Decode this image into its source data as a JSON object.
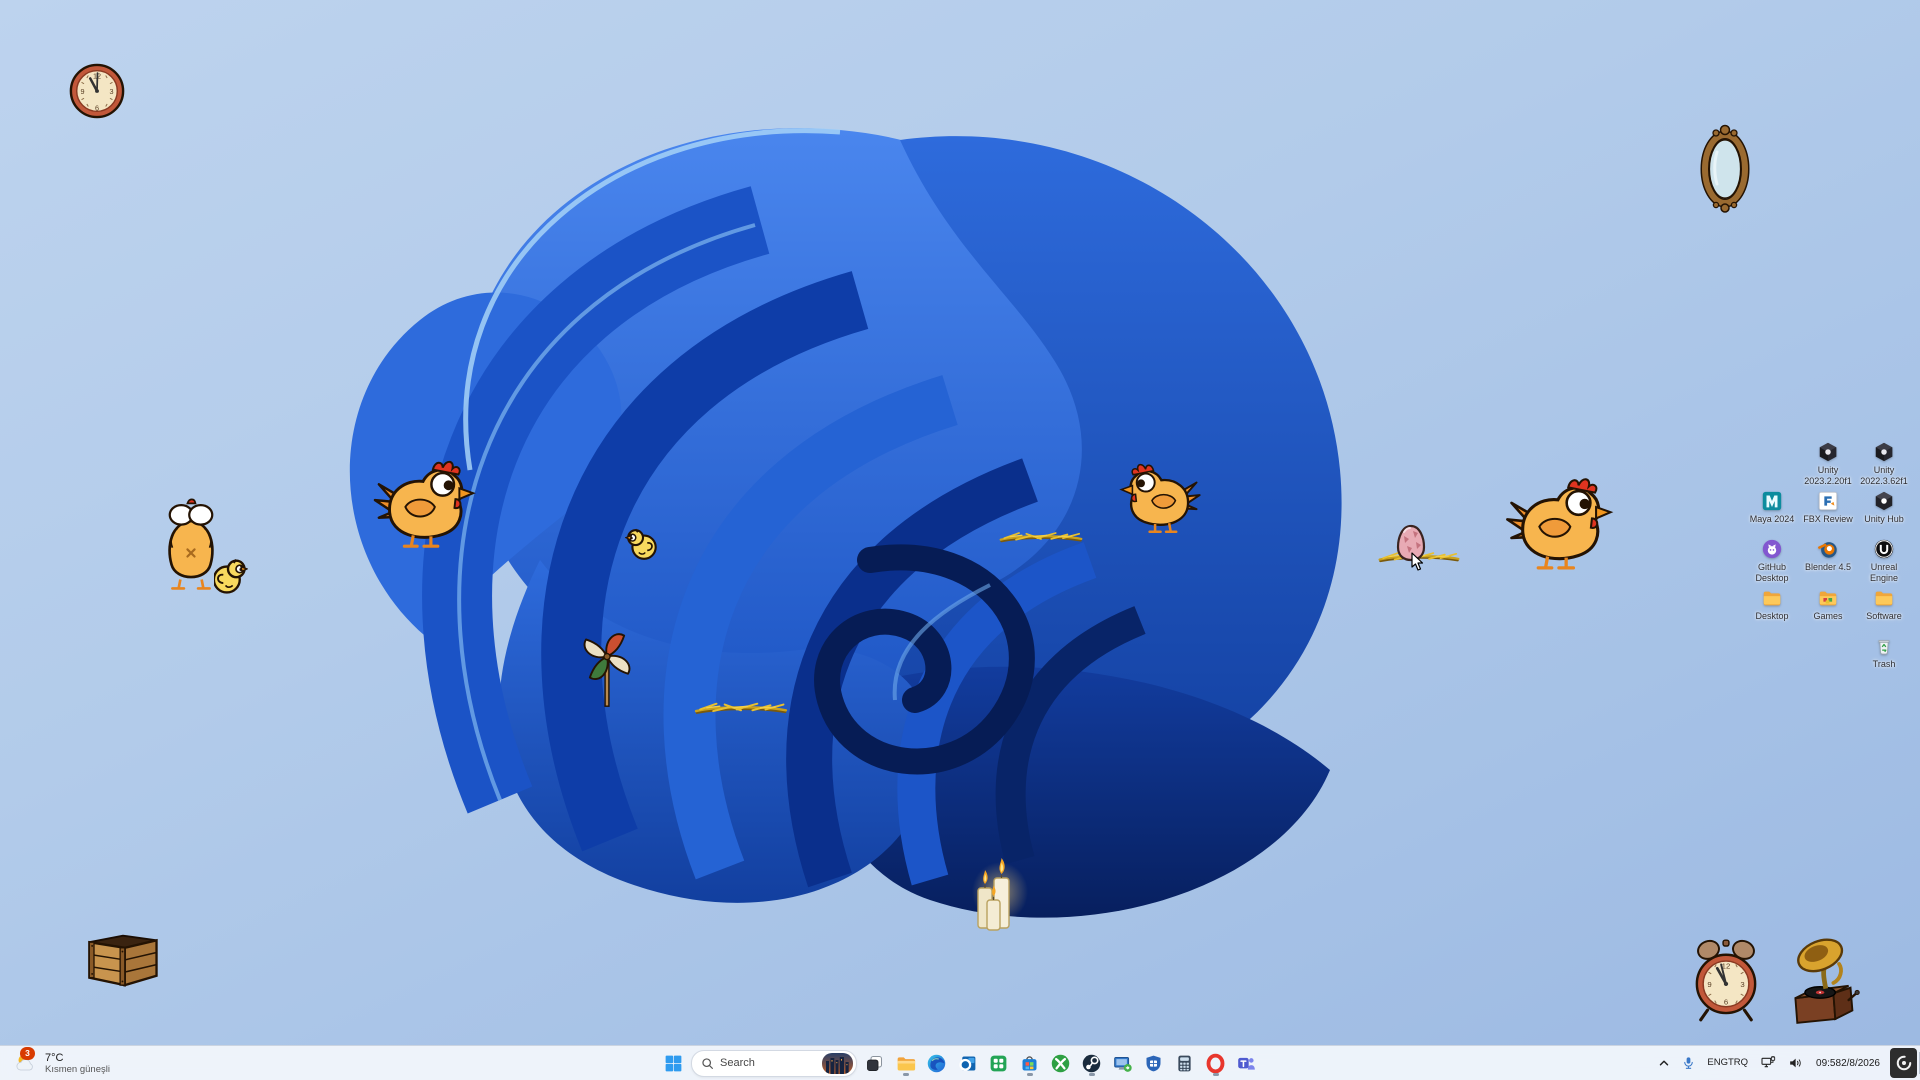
{
  "weather": {
    "badge": "3",
    "temp": "7°C",
    "condition": "Kısmen güneşli"
  },
  "search": {
    "placeholder": "Search"
  },
  "tray": {
    "lang_line1": "ENG",
    "lang_line2": "TRQ",
    "time": "09:58",
    "date": "2/8/2026"
  },
  "clock_numbers": {
    "n12": "12",
    "n3": "3",
    "n6": "6",
    "n9": "9"
  },
  "desktop_icons": [
    {
      "name": "unity-2023",
      "label": "Unity\n2023.2.20f1"
    },
    {
      "name": "unity-2022",
      "label": "Unity\n2022.3.62f1"
    },
    {
      "name": "maya-2024",
      "label": "Maya 2024"
    },
    {
      "name": "fbx-review",
      "label": "FBX Review"
    },
    {
      "name": "unity-hub",
      "label": "Unity Hub"
    },
    {
      "name": "github-desktop",
      "label": "GitHub\nDesktop"
    },
    {
      "name": "blender-45",
      "label": "Blender 4.5"
    },
    {
      "name": "unreal-engine",
      "label": "Unreal\nEngine"
    },
    {
      "name": "desktop-folder",
      "label": "Desktop"
    },
    {
      "name": "games-folder",
      "label": "Games"
    },
    {
      "name": "software-folder",
      "label": "Software"
    },
    {
      "name": "trash",
      "label": "Trash"
    }
  ],
  "taskbar": {
    "apps": [
      "start",
      "search",
      "task-view",
      "file-explorer",
      "edge",
      "outlook",
      "green-tiles-app",
      "microsoft-store",
      "xbox",
      "steam",
      "pc-tool",
      "security-shield",
      "calculator",
      "opera",
      "teams"
    ],
    "running_apps": [
      "file-explorer",
      "microsoft-store",
      "steam",
      "opera"
    ]
  },
  "pets": [
    "wall-clock",
    "ornate-mirror",
    "chicken-back",
    "chick",
    "chicken",
    "chick",
    "pinwheel",
    "hay-pile",
    "hay-pile",
    "chicken",
    "nest-with-egg",
    "chicken",
    "candles",
    "wooden-crate",
    "alarm-clock",
    "gramophone"
  ],
  "colors": {
    "taskbar_bg": "#f0f5fb",
    "badge_red": "#d83b01",
    "bloom_dark": "#071f5e",
    "bloom_bright": "#2e6fe0",
    "sky": "#b2cbea"
  }
}
